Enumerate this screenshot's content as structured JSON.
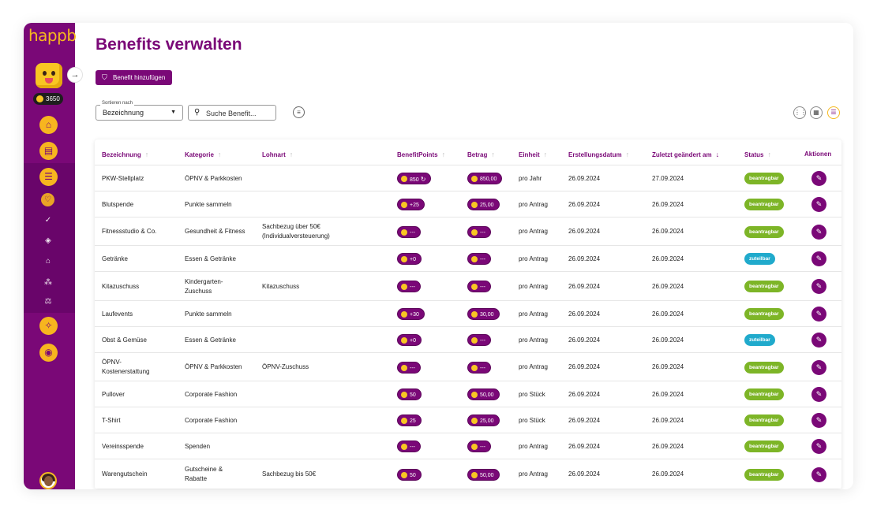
{
  "app": {
    "logo": "happb",
    "points": "3650"
  },
  "page": {
    "title": "Benefits verwalten",
    "add_button": "Benefit hinzufügen"
  },
  "toolbar": {
    "sort_label": "Sortieren nach",
    "sort_value": "Bezeichnung",
    "search_placeholder": "Suche Benefit..."
  },
  "table": {
    "columns": [
      "Bezeichnung",
      "Kategorie",
      "Lohnart",
      "BenefitPoints",
      "Betrag",
      "Einheit",
      "Erstellungsdatum",
      "Zuletzt geändert am",
      "Status",
      "Aktionen"
    ],
    "rows": [
      {
        "name": [
          "PKW-Stellplatz"
        ],
        "category": [
          "ÖPNV & Parkkosten"
        ],
        "wage": [],
        "points": "850",
        "points_recurring": true,
        "amount": "850,00",
        "unit": "pro Jahr",
        "created": "26.09.2024",
        "modified": "27.09.2024",
        "status": "beantragbar",
        "status_color": "green"
      },
      {
        "name": [
          "Blutspende"
        ],
        "category": [
          "Punkte sammeln"
        ],
        "wage": [],
        "points": "+25",
        "amount": "25,00",
        "unit": "pro Antrag",
        "created": "26.09.2024",
        "modified": "26.09.2024",
        "status": "beantragbar",
        "status_color": "green"
      },
      {
        "name": [
          "Fitnessstudio & Co."
        ],
        "category": [
          "Gesundheit & Fitness"
        ],
        "wage": [
          "Sachbezug über 50€",
          "(Individualversteuerung)"
        ],
        "points": "---",
        "amount": "---",
        "unit": "pro Antrag",
        "created": "26.09.2024",
        "modified": "26.09.2024",
        "status": "beantragbar",
        "status_color": "green"
      },
      {
        "name": [
          "Getränke"
        ],
        "category": [
          "Essen & Getränke"
        ],
        "wage": [],
        "points": "+0",
        "amount": "---",
        "unit": "pro Antrag",
        "created": "26.09.2024",
        "modified": "26.09.2024",
        "status": "zuteilbar",
        "status_color": "blue"
      },
      {
        "name": [
          "Kitazuschuss"
        ],
        "category": [
          "Kindergarten-",
          "Zuschuss"
        ],
        "wage": [
          "Kitazuschuss"
        ],
        "points": "---",
        "amount": "---",
        "unit": "pro Antrag",
        "created": "26.09.2024",
        "modified": "26.09.2024",
        "status": "beantragbar",
        "status_color": "green"
      },
      {
        "name": [
          "Laufevents"
        ],
        "category": [
          "Punkte sammeln"
        ],
        "wage": [],
        "points": "+30",
        "amount": "30,00",
        "unit": "pro Antrag",
        "created": "26.09.2024",
        "modified": "26.09.2024",
        "status": "beantragbar",
        "status_color": "green"
      },
      {
        "name": [
          "Obst & Gemüse"
        ],
        "category": [
          "Essen & Getränke"
        ],
        "wage": [],
        "points": "+0",
        "amount": "---",
        "unit": "pro Antrag",
        "created": "26.09.2024",
        "modified": "26.09.2024",
        "status": "zuteilbar",
        "status_color": "blue"
      },
      {
        "name": [
          "ÖPNV-",
          "Kostenerstattung"
        ],
        "category": [
          "ÖPNV & Parkkosten"
        ],
        "wage": [
          "ÖPNV-Zuschuss"
        ],
        "points": "---",
        "amount": "---",
        "unit": "pro Antrag",
        "created": "26.09.2024",
        "modified": "26.09.2024",
        "status": "beantragbar",
        "status_color": "green"
      },
      {
        "name": [
          "Pullover"
        ],
        "category": [
          "Corporate Fashion"
        ],
        "wage": [],
        "points": "50",
        "amount": "50,00",
        "unit": "pro Stück",
        "created": "26.09.2024",
        "modified": "26.09.2024",
        "status": "beantragbar",
        "status_color": "green"
      },
      {
        "name": [
          "T-Shirt"
        ],
        "category": [
          "Corporate Fashion"
        ],
        "wage": [],
        "points": "25",
        "amount": "25,00",
        "unit": "pro Stück",
        "created": "26.09.2024",
        "modified": "26.09.2024",
        "status": "beantragbar",
        "status_color": "green"
      },
      {
        "name": [
          "Vereinsspende"
        ],
        "category": [
          "Spenden"
        ],
        "wage": [],
        "points": "---",
        "amount": "---",
        "unit": "pro Antrag",
        "created": "26.09.2024",
        "modified": "26.09.2024",
        "status": "beantragbar",
        "status_color": "green"
      },
      {
        "name": [
          "Warengutschein"
        ],
        "category": [
          "Gutscheine &",
          "Rabatte"
        ],
        "wage": [
          "Sachbezug bis 50€"
        ],
        "points": "50",
        "amount": "50,00",
        "unit": "pro Antrag",
        "created": "26.09.2024",
        "modified": "26.09.2024",
        "status": "beantragbar",
        "status_color": "green"
      }
    ]
  },
  "icons": {
    "sidebar": [
      "home-icon",
      "document-icon",
      "sliders-icon",
      "heart-icon",
      "check-badge-icon",
      "layers-icon",
      "bank-icon",
      "people-icon",
      "scale-icon",
      "gift-search-icon",
      "coin-icon"
    ]
  },
  "colors": {
    "brand": "#7a0877",
    "accent": "#f6b91e",
    "status_green": "#7db527",
    "status_blue": "#20aacc"
  }
}
